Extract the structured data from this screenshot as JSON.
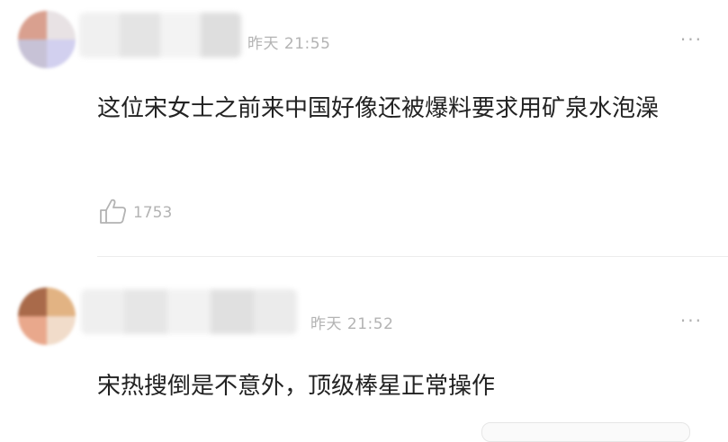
{
  "comments": [
    {
      "time": "昨天 21:55",
      "more_label": "···",
      "text": "这位宋女士之前来中国好像还被爆料要求用矿泉水泡澡",
      "likes": "1753"
    },
    {
      "time": "昨天 21:52",
      "more_label": "···",
      "text": "宋热搜倒是不意外，顶级棒星正常操作"
    }
  ],
  "colors": {
    "text": "#222222",
    "meta": "#b3b3b3",
    "divider": "#ececec"
  },
  "icons": [
    "thumbs-up-icon",
    "more-icon"
  ]
}
